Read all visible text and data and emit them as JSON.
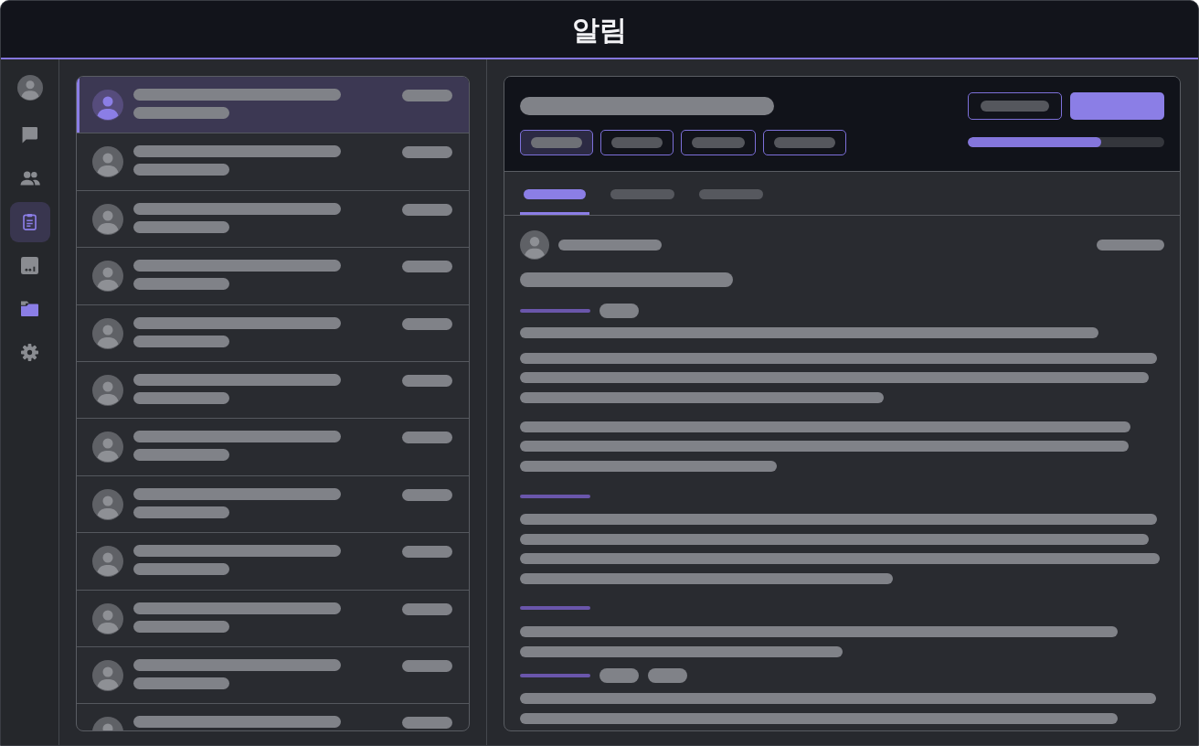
{
  "title_bar": {
    "title": "알림"
  },
  "nav_rail": {
    "items": [
      {
        "selected": false
      },
      {
        "selected": false
      },
      {
        "selected": true
      },
      {
        "selected": false
      },
      {
        "selected": false
      },
      {
        "selected": false
      }
    ]
  },
  "notification_list": {
    "items": [
      {
        "selected": true
      },
      {
        "selected": false
      },
      {
        "selected": false
      },
      {
        "selected": false
      },
      {
        "selected": false
      },
      {
        "selected": false
      },
      {
        "selected": false
      },
      {
        "selected": false
      },
      {
        "selected": false
      },
      {
        "selected": false
      },
      {
        "selected": false
      },
      {
        "selected": false
      }
    ]
  },
  "detail": {
    "filter_chips": [
      {
        "selected": true
      },
      {
        "selected": false
      },
      {
        "selected": false
      },
      {
        "selected": false
      }
    ],
    "progress": {
      "level": 0.68
    },
    "tabs": [
      {
        "selected": true
      },
      {
        "selected": false
      },
      {
        "selected": false
      }
    ]
  }
}
